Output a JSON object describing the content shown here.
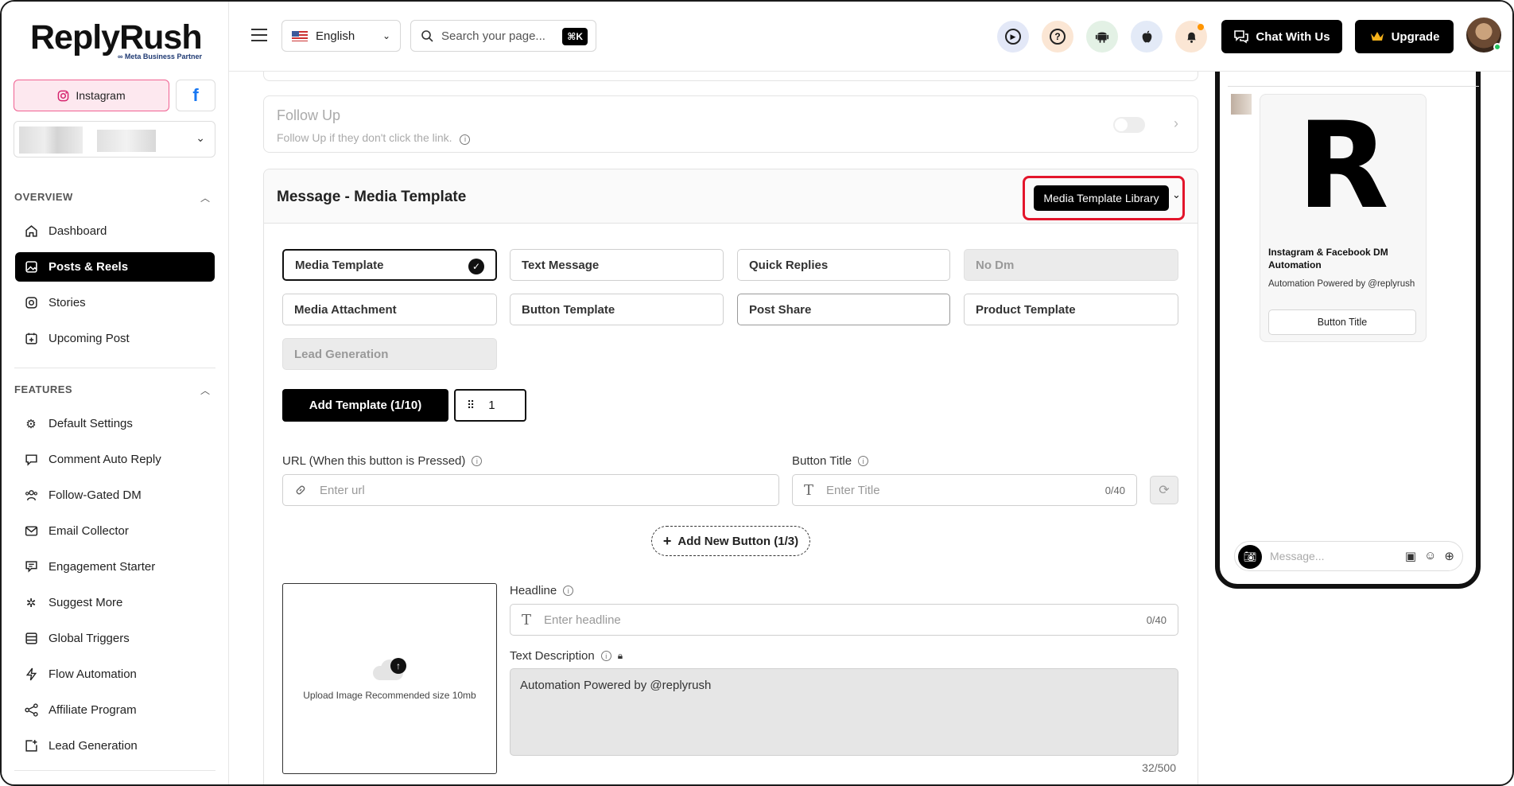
{
  "brand": {
    "name": "ReplyRush",
    "partner": "∞ Meta Business Partner"
  },
  "platforms": {
    "instagram": "Instagram",
    "facebook": "f"
  },
  "sidebar": {
    "overview_label": "OVERVIEW",
    "overview_items": [
      {
        "label": "Dashboard",
        "icon": "home-icon"
      },
      {
        "label": "Posts & Reels",
        "icon": "image-icon",
        "active": true
      },
      {
        "label": "Stories",
        "icon": "stories-icon"
      },
      {
        "label": "Upcoming Post",
        "icon": "calendar-plus-icon"
      }
    ],
    "features_label": "FEATURES",
    "features_items": [
      {
        "label": "Default Settings",
        "icon": "gear-icon"
      },
      {
        "label": "Comment Auto Reply",
        "icon": "comment-icon"
      },
      {
        "label": "Follow-Gated DM",
        "icon": "users-icon"
      },
      {
        "label": "Email Collector",
        "icon": "mail-icon"
      },
      {
        "label": "Engagement Starter",
        "icon": "chat-icon"
      },
      {
        "label": "Suggest More",
        "icon": "sparkle-gear-icon"
      },
      {
        "label": "Global Triggers",
        "icon": "list-icon"
      },
      {
        "label": "Flow Automation",
        "icon": "bolt-icon"
      },
      {
        "label": "Affiliate Program",
        "icon": "share-icon"
      },
      {
        "label": "Lead Generation",
        "icon": "add-square-icon"
      }
    ]
  },
  "header": {
    "language": "English",
    "search_placeholder": "Search your page...",
    "shortcut": "⌘K",
    "chat_label": "Chat With Us",
    "upgrade_label": "Upgrade"
  },
  "followup": {
    "title": "Follow Up",
    "subtitle": "Follow Up if they don't click the link."
  },
  "message": {
    "title": "Message - Media Template",
    "library_button": "Media Template Library",
    "options_row1": [
      "Media Template",
      "Text Message",
      "Quick Replies",
      "No Dm"
    ],
    "options_row2": [
      "Media Attachment",
      "Button Template",
      "Post Share",
      "Product Template"
    ],
    "option_row3": "Lead Generation",
    "add_template": "Add Template (1/10)",
    "template_index": "1",
    "url_label": "URL (When this button is Pressed)",
    "url_placeholder": "Enter url",
    "button_title_label": "Button Title",
    "button_title_placeholder": "Enter Title",
    "button_title_count": "0/40",
    "add_button": "Add New Button (1/3)",
    "upload_text": "Upload Image Recommended size 10mb",
    "headline_label": "Headline",
    "headline_placeholder": "Enter headline",
    "headline_count": "0/40",
    "description_label": "Text Description",
    "description_value": "Automation Powered by @replyrush",
    "description_count": "32/500"
  },
  "preview": {
    "logo_letter": "R",
    "card_title": "Instagram & Facebook DM Automation",
    "card_subtitle": "Automation Powered by @replyrush",
    "card_button": "Button Title",
    "message_placeholder": "Message..."
  }
}
